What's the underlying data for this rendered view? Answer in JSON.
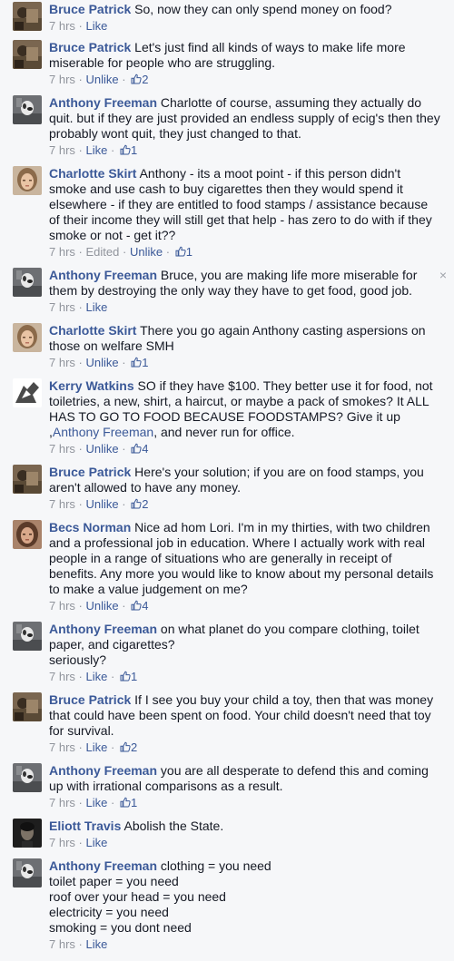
{
  "comments": [
    {
      "name": "Bruce Patrick",
      "text": "So, now they can only spend money on food?",
      "time": "7 hrs",
      "action": "Like",
      "avatar": "bruce"
    },
    {
      "name": "Bruce Patrick",
      "text": "Let's just find all kinds of ways to make life more miserable for people who are struggling.",
      "time": "7 hrs",
      "action": "Unlike",
      "likes": "2",
      "avatar": "bruce"
    },
    {
      "name": "Anthony Freeman",
      "text": "Charlotte of course, assuming they actually do quit. but if they are just provided an endless supply of ecig's then they probably wont quit, they just changed to that.",
      "time": "7 hrs",
      "action": "Like",
      "likes": "1",
      "avatar": "anthony"
    },
    {
      "name": "Charlotte Skirt",
      "text": "Anthony - its a moot point - if this person didn't smoke and use cash to buy cigarettes then they would spend it elsewhere - if they are entitled to food stamps / assistance because of their income they will still get that help - has zero to do with if they smoke or not - get it??",
      "time": "7 hrs",
      "edited": "Edited",
      "action": "Unlike",
      "likes": "1",
      "avatar": "charlotte"
    },
    {
      "name": "Anthony Freeman",
      "text": "Bruce, you are making life more miserable for them by destroying the only way they have to get food, good job.",
      "time": "7 hrs",
      "action": "Like",
      "avatar": "anthony",
      "close": "×"
    },
    {
      "name": "Charlotte Skirt",
      "text": "There you go again Anthony casting aspersions on those on welfare SMH",
      "time": "7 hrs",
      "action": "Unlike",
      "likes": "1",
      "avatar": "charlotte"
    },
    {
      "name": "Kerry Watkins",
      "text": "SO if they have $100. They better use it for food, not toiletries, a new, shirt, a haircut, or maybe a pack of smokes? It ALL HAS TO GO TO FOOD BECAUSE FOODSTAMPS? Give it up ,",
      "mention": "Anthony Freeman",
      "text_after": ", and never run for office.",
      "time": "7 hrs",
      "action": "Unlike",
      "likes": "4",
      "avatar": "kerry"
    },
    {
      "name": "Bruce Patrick",
      "text": "Here's your solution; if you are on food stamps, you aren't allowed to have any money.",
      "time": "7 hrs",
      "action": "Unlike",
      "likes": "2",
      "avatar": "bruce"
    },
    {
      "name": "Becs Norman",
      "text": "Nice ad hom Lori. I'm in my thirties, with two children and a professional job in education. Where I actually work with real people in a range of situations who are generally in receipt of benefits. Any more you would like to know about my personal details to make a value judgement on me?",
      "time": "7 hrs",
      "action": "Unlike",
      "likes": "4",
      "avatar": "becs"
    },
    {
      "name": "Anthony Freeman",
      "text": "on what planet do you compare clothing, toilet paper, and cigarettes?\nseriously?",
      "time": "7 hrs",
      "action": "Like",
      "likes": "1",
      "avatar": "anthony"
    },
    {
      "name": "Bruce Patrick",
      "text": "If I see you buy your child a toy, then that was money that could have been spent on food. Your child doesn't need that toy for survival.",
      "time": "7 hrs",
      "action": "Like",
      "likes": "2",
      "avatar": "bruce"
    },
    {
      "name": "Anthony Freeman",
      "text": "you are all desperate to defend this and coming up with irrational comparisons as a result.",
      "time": "7 hrs",
      "action": "Like",
      "likes": "1",
      "avatar": "anthony"
    },
    {
      "name": "Eliott Travis",
      "text": "Abolish the State.",
      "time": "7 hrs",
      "action": "Like",
      "avatar": "eliott"
    },
    {
      "name": "Anthony Freeman",
      "text": "clothing = you need\ntoilet paper = you need\nroof over your head = you need\nelectricity = you need\nsmoking = you dont need",
      "time": "7 hrs",
      "action": "Like",
      "avatar": "anthony"
    }
  ],
  "separator": "·",
  "colors": {
    "link": "#3b5998",
    "meta": "#90949c",
    "background": "#f6f7f9"
  }
}
